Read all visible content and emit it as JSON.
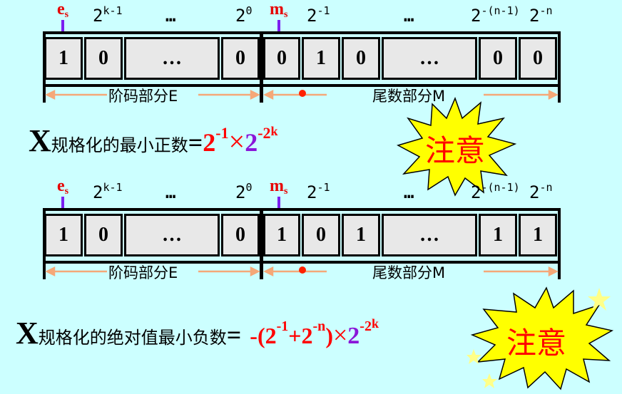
{
  "diagram1": {
    "exp_sign_label": "e",
    "exp_sign_sub": "s",
    "mant_sign_label": "m",
    "mant_sign_sub": "s",
    "headers": [
      {
        "base": "2",
        "exp": "k-1"
      },
      {
        "text": "…"
      },
      {
        "base": "2",
        "exp": "0"
      },
      {
        "base": "2",
        "exp": "-1"
      },
      {
        "text": "…"
      },
      {
        "base": "2",
        "exp": "-(n-1)"
      },
      {
        "base": "2",
        "exp": "-n"
      }
    ],
    "cells": [
      "1",
      "0",
      "…",
      "0",
      "0",
      "1",
      "0",
      "…",
      "0",
      "0"
    ],
    "exp_part_label": "阶码部分E",
    "mant_part_label": "尾数部分M"
  },
  "formula1": {
    "x": "X",
    "sub": "规格化的最小正数",
    "eq": "=",
    "t1_base": "2",
    "t1_exp": "-1",
    "times": "×",
    "t2_base": "2",
    "t2_exp": "-2",
    "t2_exp2": "k"
  },
  "note1": {
    "text": "注意",
    "star_color": "#ffff00"
  },
  "diagram2": {
    "exp_sign_label": "e",
    "exp_sign_sub": "s",
    "mant_sign_label": "m",
    "mant_sign_sub": "s",
    "headers": [
      {
        "base": "2",
        "exp": "k-1"
      },
      {
        "text": "…"
      },
      {
        "base": "2",
        "exp": "0"
      },
      {
        "base": "2",
        "exp": "-1"
      },
      {
        "text": "…"
      },
      {
        "base": "2",
        "exp": "-(n-1)"
      },
      {
        "base": "2",
        "exp": "-n"
      }
    ],
    "cells": [
      "1",
      "0",
      "…",
      "0",
      "1",
      "0",
      "1",
      "…",
      "1",
      "1"
    ],
    "exp_part_label": "阶码部分E",
    "mant_part_label": "尾数部分M"
  },
  "formula2": {
    "x": "X",
    "sub": "规格化的绝对值最小负数",
    "eq": "=",
    "t1": "-(2",
    "t1_exp": "-1",
    "plus": "+2",
    "t2_exp": "-n",
    "close": ")",
    "times": "×",
    "t3_base": "2",
    "t3_exp": "-2",
    "t3_exp2": "k"
  },
  "note2": {
    "text": "注意",
    "star_color": "#ffff00"
  },
  "colors": {
    "background": "#ccffff",
    "red": "#ff0000",
    "purple": "#8a16d8",
    "arrow": "#7b1ff0",
    "part_line": "#f5a878"
  }
}
